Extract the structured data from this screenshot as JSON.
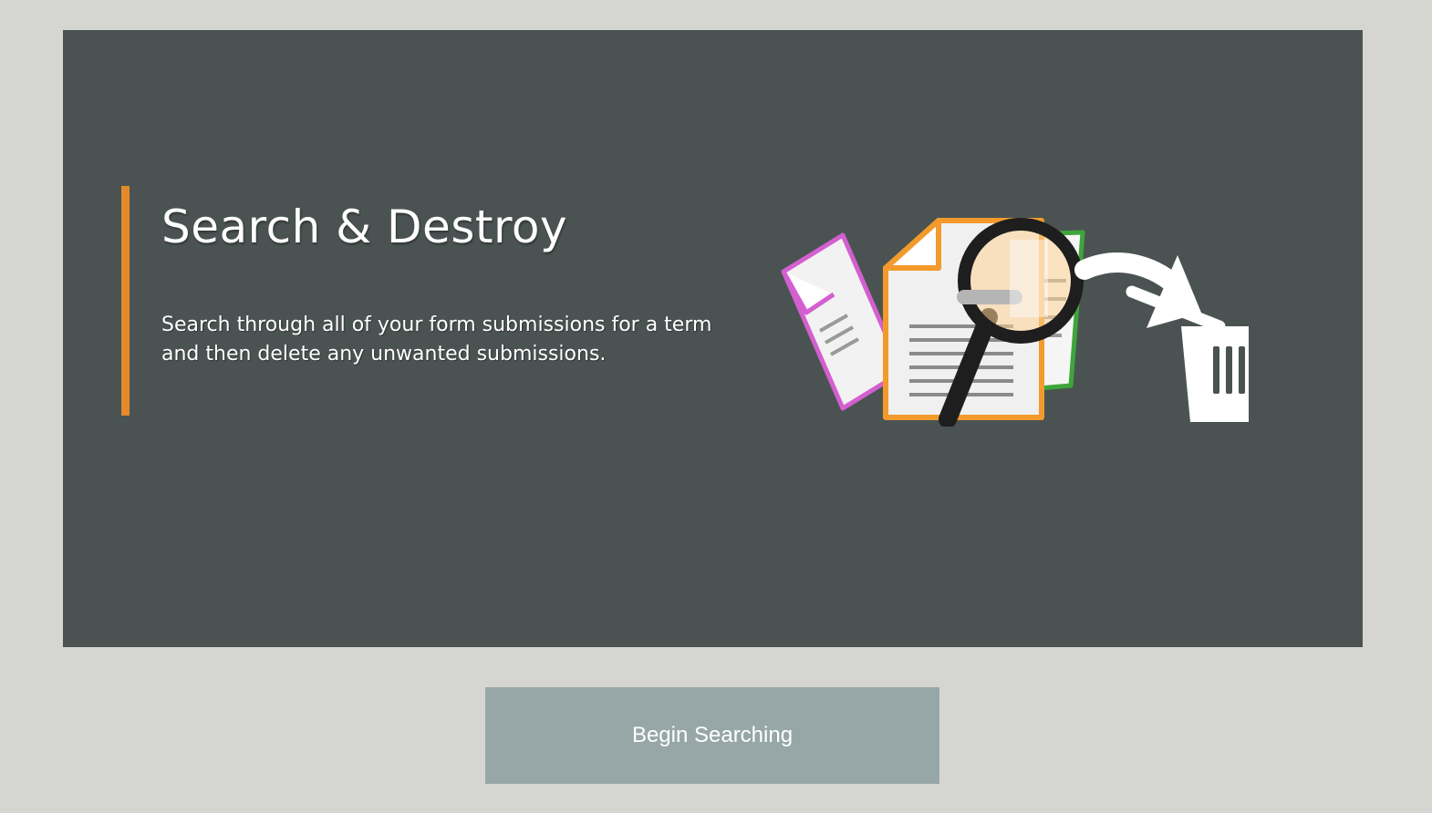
{
  "hero": {
    "title": "Search & Destroy",
    "description": "Search through all of your form submissions for a term and then delete any unwanted submissions.",
    "background_color": "#4a5352",
    "accent_color": "#e58a2b"
  },
  "illustration": {
    "icons": [
      "documents-icon",
      "magnifying-glass-icon",
      "arrow-icon",
      "trash-can-icon"
    ],
    "colors": {
      "pink_doc": "#d35fd0",
      "green_doc": "#3ea53a",
      "orange_doc": "#f29a2c",
      "magnifier": "#1e1e1e",
      "trash": "#ffffff"
    }
  },
  "actions": {
    "begin_label": "Begin Searching",
    "button_color": "#97a7a7"
  },
  "page": {
    "background_color": "#d5d6d2"
  }
}
